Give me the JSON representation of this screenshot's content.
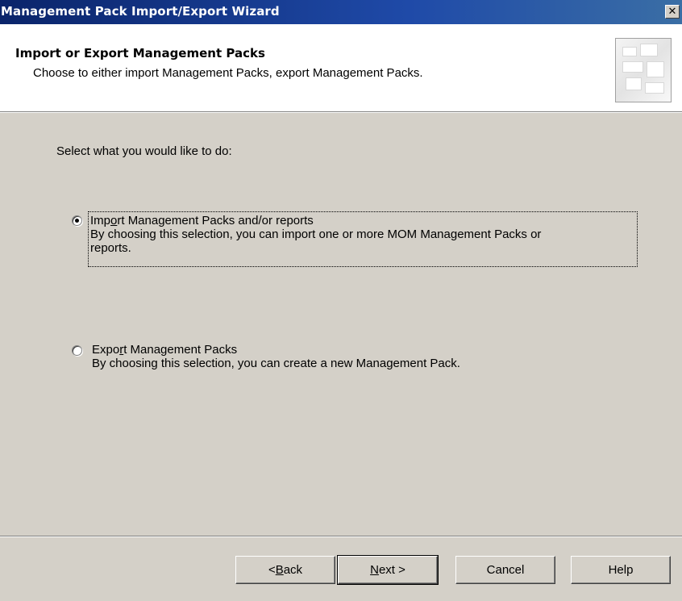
{
  "window": {
    "title": "Management Pack Import/Export Wizard",
    "close_glyph": "✕"
  },
  "header": {
    "title": "Import or Export Management Packs",
    "subtitle": "Choose to either import Management Packs, export Management Packs."
  },
  "main": {
    "prompt": "Select what you would like to do:",
    "options": [
      {
        "label_pre": "Imp",
        "label_accel": "o",
        "label_post": "rt Management Packs and/or reports",
        "description_line1": "By choosing this selection, you can import one or more MOM Management Packs or",
        "description_line2": "reports.",
        "selected": true,
        "focused": true
      },
      {
        "label_pre": "Expo",
        "label_accel": "r",
        "label_post": "t Management Packs",
        "description_line1": "By choosing this selection, you can create a new Management Pack.",
        "selected": false,
        "focused": false
      }
    ]
  },
  "footer": {
    "back": {
      "pre": "< ",
      "accel": "B",
      "post": "ack"
    },
    "next": {
      "pre": "",
      "accel": "N",
      "post": "ext >"
    },
    "cancel": "Cancel",
    "help": "Help"
  },
  "icons": {
    "header_graphic": "wizard-banner-icon",
    "close": "close-icon"
  }
}
